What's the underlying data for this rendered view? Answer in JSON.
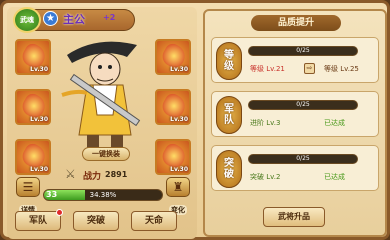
{
  "hero": {
    "rank_label": "武魂",
    "name": "主公",
    "plus": "+2",
    "swap_label": "一键换装",
    "power_label": "战力",
    "power_value": "2891",
    "level": "33",
    "exp_text": "34.38%",
    "exp_fraction": 0.3438
  },
  "equip_slots": [
    {
      "lv": "Lv.30"
    },
    {
      "lv": "Lv.30"
    },
    {
      "lv": "Lv.30"
    },
    {
      "lv": "Lv.30"
    },
    {
      "lv": "Lv.30"
    },
    {
      "lv": "Lv.30"
    }
  ],
  "side_buttons": {
    "left_label": "详情",
    "right_label": "变化"
  },
  "bottom_tabs": {
    "army": "军队",
    "breakthrough": "突破",
    "fate": "天命"
  },
  "quality_panel": {
    "title": "品质提升",
    "cards": [
      {
        "tag_top": "等",
        "tag_bottom": "级",
        "progress_text": "0/25",
        "progress_fraction": 0.0,
        "left_text": "等级 Lv.21",
        "arrow": "⇨",
        "right_text": "等级 Lv.25"
      },
      {
        "tag_top": "军",
        "tag_bottom": "队",
        "progress_text": "0/25",
        "progress_fraction": 0.0,
        "left_text": "进阶 Lv.3",
        "right_text": "已达成"
      },
      {
        "tag_top": "突",
        "tag_bottom": "破",
        "progress_text": "0/25",
        "progress_fraction": 0.0,
        "left_text": "突破 Lv.2",
        "right_text": "已达成"
      }
    ],
    "promote_label": "武将升品"
  },
  "colors": {
    "accent_red": "#c8312a",
    "accent_green": "#4a9a1c",
    "frame_brown": "#8a5a2a"
  }
}
